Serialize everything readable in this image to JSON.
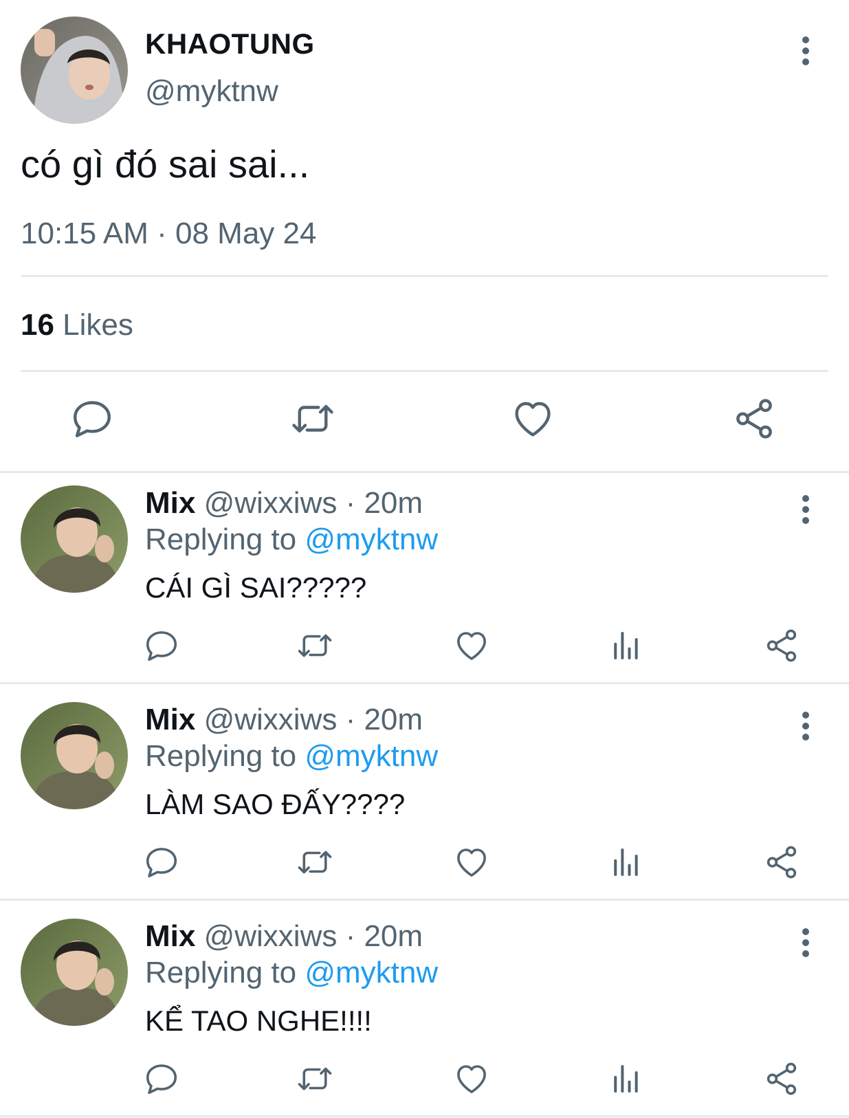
{
  "main_tweet": {
    "author_name": "KHAOTUNG",
    "author_handle": "@myktnw",
    "text": "có gì đó sai sai...",
    "timestamp": "10:15 AM · 08 May 24",
    "likes_count": "16",
    "likes_label": " Likes",
    "actions": [
      "reply-icon",
      "retweet-icon",
      "like-icon",
      "share-icon"
    ]
  },
  "replies": [
    {
      "name": "Mix",
      "handle_time": " @wixxiws · 20m",
      "replying_label": "Replying to ",
      "replying_to": "@myktnw",
      "text": "CÁI GÌ SAI?????"
    },
    {
      "name": "Mix",
      "handle_time": " @wixxiws · 20m",
      "replying_label": "Replying to ",
      "replying_to": "@myktnw",
      "text": "LÀM SAO ĐẤY????"
    },
    {
      "name": "Mix",
      "handle_time": " @wixxiws · 20m",
      "replying_label": "Replying to ",
      "replying_to": "@myktnw",
      "text": "KỂ TAO NGHE!!!!"
    }
  ],
  "reply_actions": [
    "reply-icon",
    "retweet-icon",
    "like-icon",
    "views-icon",
    "share-icon"
  ],
  "colors": {
    "text": "#0f1419",
    "secondary": "#536471",
    "accent": "#1d9bf0",
    "divider": "#e7e9ec"
  }
}
